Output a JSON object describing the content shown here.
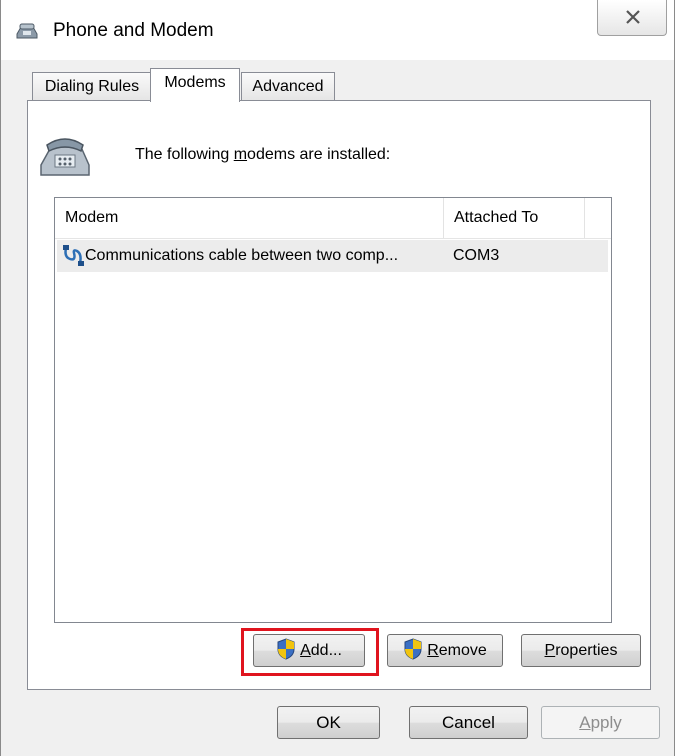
{
  "window": {
    "title": "Phone and Modem",
    "app_icon": "phone-modem-icon",
    "close_icon": "close-icon"
  },
  "tabs": [
    {
      "label": "Dialing Rules",
      "active": false
    },
    {
      "label": "Modems",
      "active": true
    },
    {
      "label": "Advanced",
      "active": false
    }
  ],
  "modems_tab": {
    "intro_before": "The following ",
    "intro_accel": "m",
    "intro_after": "odems are installed:",
    "list": {
      "columns": [
        "Modem",
        "Attached To"
      ],
      "rows": [
        {
          "modem": "Communications cable between two comp...",
          "attached_to": "COM3",
          "icon": "cable-icon"
        }
      ]
    },
    "buttons": {
      "add": {
        "accel": "A",
        "rest": "dd...",
        "icon": "uac-shield-icon"
      },
      "remove": {
        "accel": "R",
        "rest": "emove",
        "icon": "uac-shield-icon"
      },
      "properties": {
        "accel": "P",
        "rest": "roperties"
      }
    }
  },
  "dialog_buttons": {
    "ok": "OK",
    "cancel": "Cancel",
    "apply_accel": "A",
    "apply_rest": "pply"
  },
  "colors": {
    "highlight": "#e0141e",
    "row_selected": "#ececec"
  }
}
